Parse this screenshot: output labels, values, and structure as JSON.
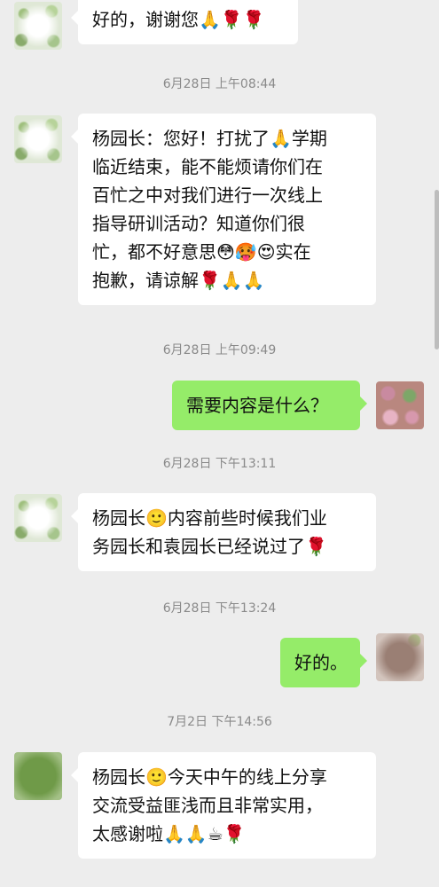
{
  "messages": [
    {
      "text_lines": [
        "好的，谢谢您🙏🌹🌹"
      ]
    },
    {
      "timestamp": "6月28日 上午08:44"
    },
    {
      "text_lines": [
        "杨园长：您好！打扰了🙏学期",
        "临近结束，能不能烦请你们在",
        "百忙之中对我们进行一次线上",
        "指导研训活动？知道你们很",
        "忙，都不好意思😳🥵😍实在",
        "抱歉，请谅解🌹🙏🙏"
      ]
    },
    {
      "timestamp": "6月28日 上午09:49"
    },
    {
      "text_lines": [
        "需要内容是什么？"
      ]
    },
    {
      "timestamp": "6月28日 下午13:11"
    },
    {
      "text_lines": [
        "杨园长🙂内容前些时候我们业",
        "务园长和袁园长已经说过了🌹"
      ]
    },
    {
      "timestamp": "6月28日 下午13:24"
    },
    {
      "text_lines": [
        "好的。"
      ]
    },
    {
      "timestamp": "7月2日 下午14:56"
    },
    {
      "text_lines": [
        "杨园长🙂今天中午的线上分享",
        "交流受益匪浅而且非常实用，",
        "太感谢啦🙏🙏☕🌹"
      ]
    }
  ]
}
